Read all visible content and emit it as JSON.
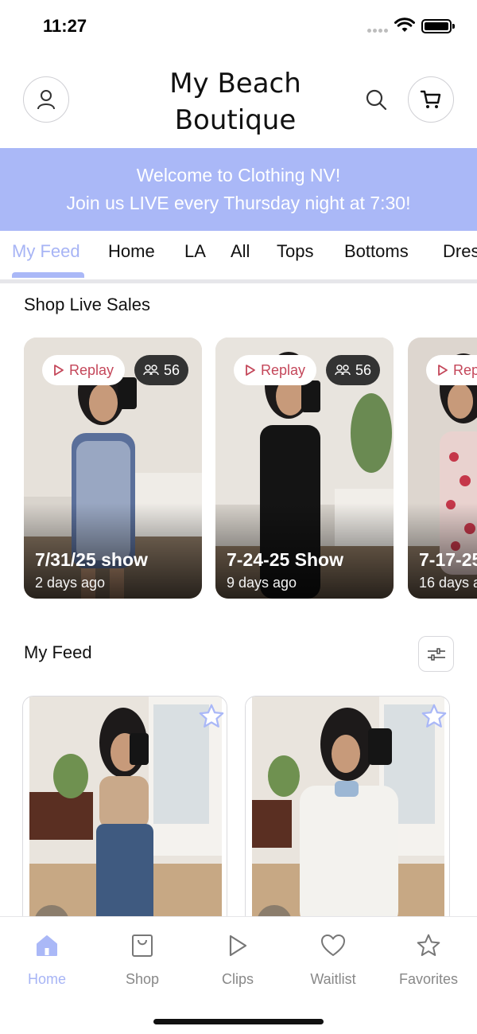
{
  "status_bar": {
    "time": "11:27"
  },
  "header": {
    "brand_line1": "My Beach",
    "brand_line2": "Boutique"
  },
  "banner": {
    "line1": "Welcome to Clothing NV!",
    "line2": "Join us LIVE every Thursday night at 7:30!",
    "color": "#aab8f7"
  },
  "tabs": [
    "My Feed",
    "Home",
    "LA",
    "All",
    "Tops",
    "Bottoms",
    "Dres"
  ],
  "active_tab": "My Feed",
  "live_section": {
    "title": "Shop Live Sales",
    "cards": [
      {
        "replay": "Replay",
        "viewers": "56",
        "title": "7/31/25 show",
        "ago": "2 days ago"
      },
      {
        "replay": "Replay",
        "viewers": "56",
        "title": "7-24-25 Show",
        "ago": "9 days ago"
      },
      {
        "replay": "Rep",
        "viewers": "",
        "title": "7-17-25",
        "ago": "16 days a"
      }
    ]
  },
  "feed_section": {
    "title": "My Feed"
  },
  "bottom_nav": [
    {
      "label": "Home",
      "icon": "home-icon",
      "active": true
    },
    {
      "label": "Shop",
      "icon": "shopping-bag-icon",
      "active": false
    },
    {
      "label": "Clips",
      "icon": "play-icon",
      "active": false
    },
    {
      "label": "Waitlist",
      "icon": "heart-icon",
      "active": false
    },
    {
      "label": "Favorites",
      "icon": "star-icon",
      "active": false
    }
  ],
  "accent_color": "#a7b4f5",
  "replay_color": "#c4475a"
}
